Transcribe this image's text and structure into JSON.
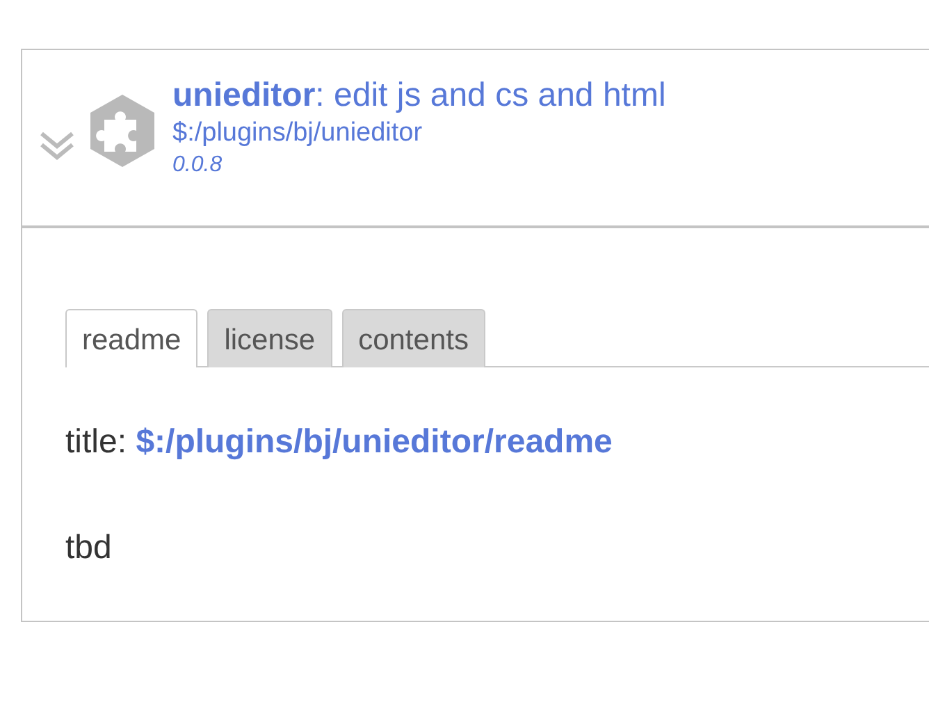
{
  "plugin": {
    "expanded": true,
    "heading": "**unieditor**: edit js and cs and html",
    "path": "$:/plugins/bj/unieditor",
    "version": "0.0.8"
  },
  "tabs": [
    {
      "label": "readme",
      "selected": true
    },
    {
      "label": "license",
      "selected": false
    },
    {
      "label": "contents",
      "selected": false
    }
  ],
  "content": {
    "field_label": "title:",
    "field_value": "$:/plugins/bj/unieditor/readme",
    "body": "tbd"
  }
}
